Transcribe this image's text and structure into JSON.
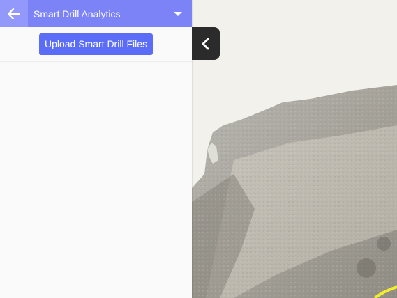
{
  "sidebar": {
    "back_icon": "arrow-left-icon",
    "title": "Smart Drill Analytics",
    "dropdown_icon": "caret-down-icon",
    "upload_label": "Upload Smart Drill Files"
  },
  "collapse_toggle": {
    "icon": "chevron-left-icon"
  },
  "colors": {
    "header": "#7c83f7",
    "back_button": "#9399fa",
    "upload_button": "#5b6cf6",
    "toggle": "#2b2b2b",
    "map_background": "#f3f1ec",
    "drill_line": "#f4ee2a"
  }
}
